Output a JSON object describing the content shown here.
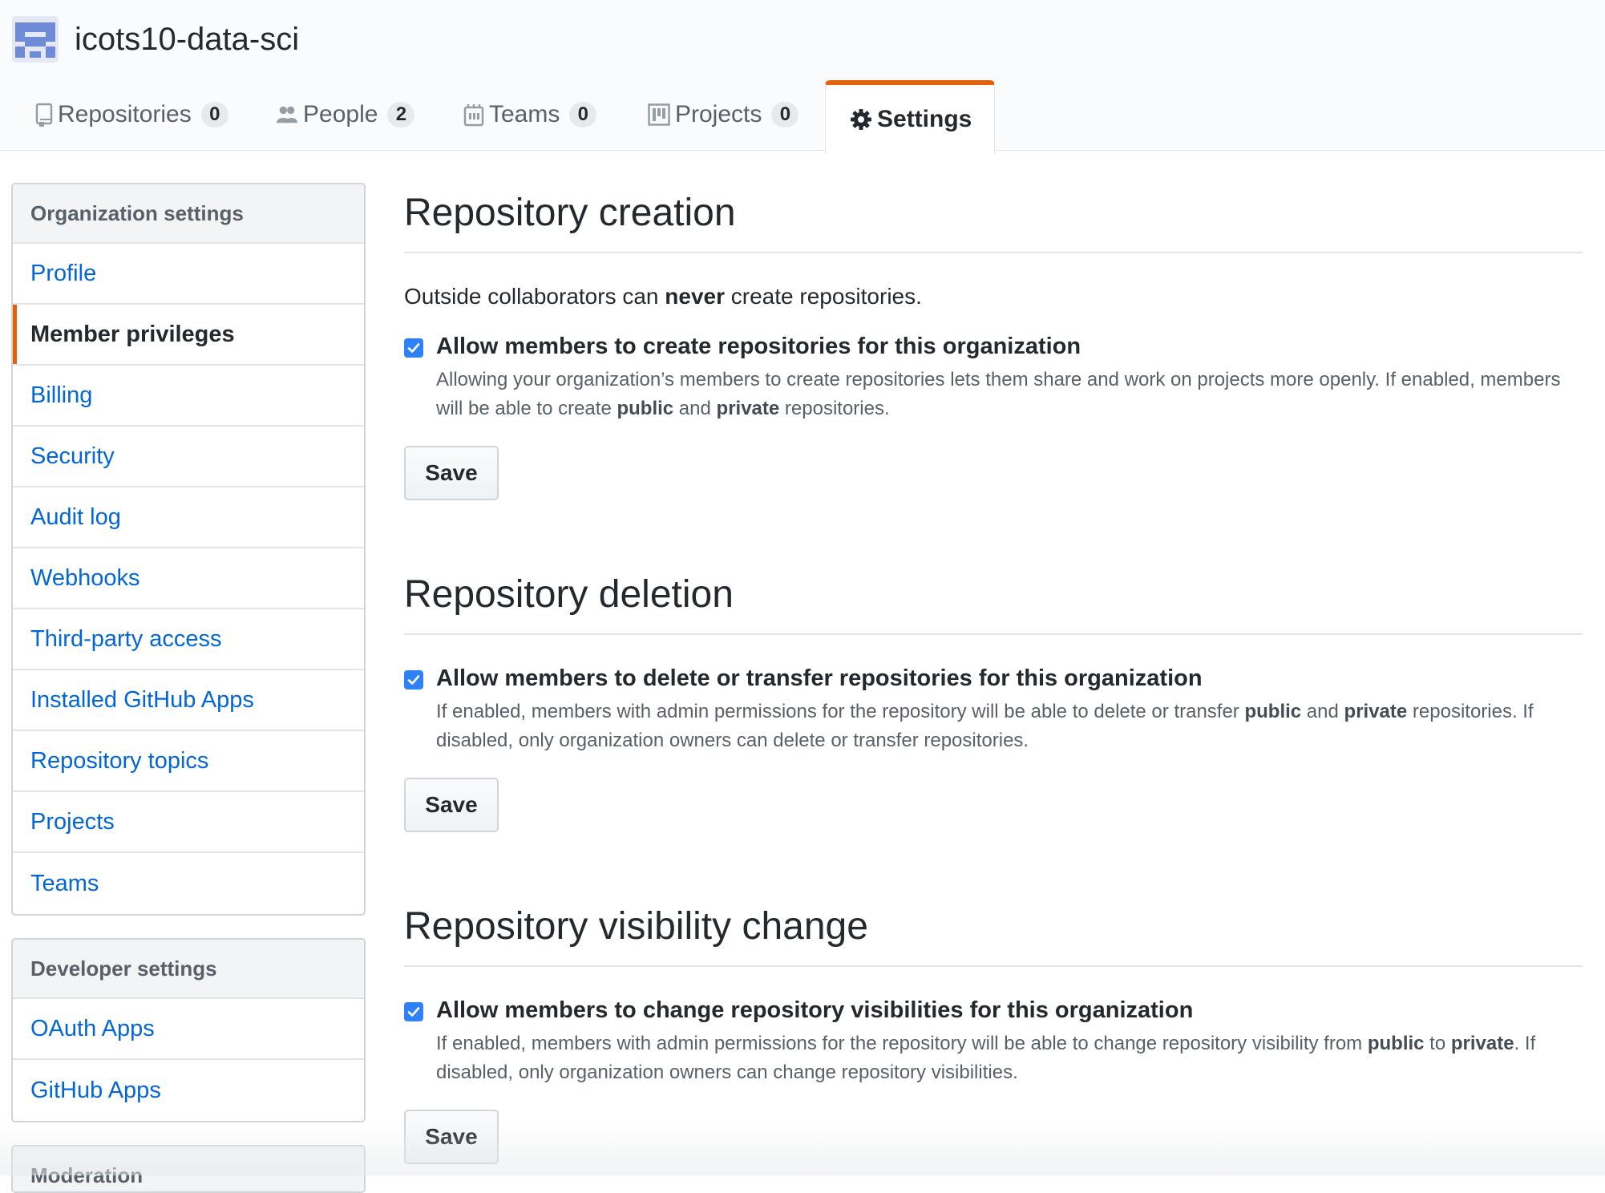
{
  "org": {
    "name": "icots10-data-sci"
  },
  "tabs": [
    {
      "label": "Repositories",
      "count": "0",
      "icon": "repo-icon"
    },
    {
      "label": "People",
      "count": "2",
      "icon": "people-icon"
    },
    {
      "label": "Teams",
      "count": "0",
      "icon": "teams-icon"
    },
    {
      "label": "Projects",
      "count": "0",
      "icon": "project-icon"
    },
    {
      "label": "Settings",
      "icon": "gear-icon",
      "selected": true
    }
  ],
  "sidebar": {
    "org_settings": {
      "heading": "Organization settings",
      "items": [
        {
          "label": "Profile"
        },
        {
          "label": "Member privileges",
          "selected": true
        },
        {
          "label": "Billing"
        },
        {
          "label": "Security"
        },
        {
          "label": "Audit log"
        },
        {
          "label": "Webhooks"
        },
        {
          "label": "Third-party access"
        },
        {
          "label": "Installed GitHub Apps"
        },
        {
          "label": "Repository topics"
        },
        {
          "label": "Projects"
        },
        {
          "label": "Teams"
        }
      ]
    },
    "dev_settings": {
      "heading": "Developer settings",
      "items": [
        {
          "label": "OAuth Apps"
        },
        {
          "label": "GitHub Apps"
        }
      ]
    },
    "moderation": {
      "heading": "Moderation"
    }
  },
  "sections": {
    "creation": {
      "title": "Repository creation",
      "note_prefix": "Outside collaborators can ",
      "note_bold": "never",
      "note_suffix": " create repositories.",
      "checkbox_label": "Allow members to create repositories for this organization",
      "checked": true,
      "desc_1": "Allowing your organization’s members to create repositories lets them share and work on projects more openly. If enabled, members will be able to create ",
      "desc_b1": "public",
      "desc_2": " and ",
      "desc_b2": "private",
      "desc_3": " repositories.",
      "button": "Save"
    },
    "deletion": {
      "title": "Repository deletion",
      "checkbox_label": "Allow members to delete or transfer repositories for this organization",
      "checked": true,
      "desc_1": "If enabled, members with admin permissions for the repository will be able to delete or transfer ",
      "desc_b1": "public",
      "desc_2": " and ",
      "desc_b2": "private",
      "desc_3": " repositories. If disabled, only organization owners can delete or transfer repositories.",
      "button": "Save"
    },
    "visibility": {
      "title": "Repository visibility change",
      "checkbox_label": "Allow members to change repository visibilities for this organization",
      "checked": true,
      "desc_1": "If enabled, members with admin permissions for the repository will be able to change repository visibility from ",
      "desc_b1": "public",
      "desc_2": " to ",
      "desc_b2": "private",
      "desc_3": ". If disabled, only organization owners can change repository visibilities.",
      "button": "Save"
    }
  },
  "colors": {
    "accent": "#e36209",
    "link": "#0366d6",
    "checkbox": "#2f81f7"
  }
}
